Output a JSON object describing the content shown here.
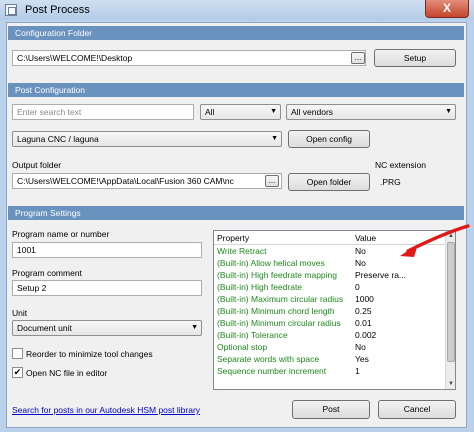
{
  "window": {
    "title": "Post Process",
    "close_label": "X"
  },
  "configuration": {
    "section_title": "Configuration Folder",
    "folder_value": "C:\\Users\\WELCOME!\\Desktop",
    "browse_label": "...",
    "setup_label": "Setup"
  },
  "post_config": {
    "section_title": "Post Configuration",
    "search_placeholder": "Enter search text",
    "filter_all": "All",
    "vendor_filter": "All vendors",
    "post_selected": "Laguna CNC / laguna",
    "open_config_label": "Open config",
    "output_folder_label": "Output folder",
    "output_folder_value": "C:\\Users\\WELCOME!\\AppData\\Local\\Fusion 360 CAM\\nc",
    "browse_label": "...",
    "open_folder_label": "Open folder",
    "nc_extension_label": "NC extension",
    "nc_extension_value": ".PRG"
  },
  "program_settings": {
    "section_title": "Program Settings",
    "program_name_label": "Program name or number",
    "program_name_value": "1001",
    "program_comment_label": "Program comment",
    "program_comment_value": "Setup 2",
    "unit_label": "Unit",
    "unit_value": "Document unit",
    "reorder_label": "Reorder to minimize tool changes",
    "reorder_checked": false,
    "open_nc_label": "Open NC file in editor",
    "open_nc_checked": true
  },
  "property_grid": {
    "header_property": "Property",
    "header_value": "Value",
    "rows": [
      {
        "property": "Write Retract",
        "value": "No"
      },
      {
        "property": "(Built-in) Allow helical moves",
        "value": "No"
      },
      {
        "property": "(Built-in) High feedrate mapping",
        "value": "Preserve ra..."
      },
      {
        "property": "(Built-in) High feedrate",
        "value": "0"
      },
      {
        "property": "(Built-in) Maximum circular radius",
        "value": "1000"
      },
      {
        "property": "(Built-in) Minimum chord length",
        "value": "0.25"
      },
      {
        "property": "(Built-in) Minimum circular radius",
        "value": "0.01"
      },
      {
        "property": "(Built-in) Tolerance",
        "value": "0.002"
      },
      {
        "property": "Optional stop",
        "value": "No"
      },
      {
        "property": "Separate words with space",
        "value": "Yes"
      },
      {
        "property": "Sequence number increment",
        "value": "1"
      }
    ]
  },
  "footer": {
    "search_link": "Search for posts in our Autodesk HSM post library",
    "post_label": "Post",
    "cancel_label": "Cancel"
  },
  "colors": {
    "section_header": "#6a92be",
    "property_text": "#1e8a1e",
    "annotation_arrow": "#e01818",
    "link": "#0000cc"
  }
}
